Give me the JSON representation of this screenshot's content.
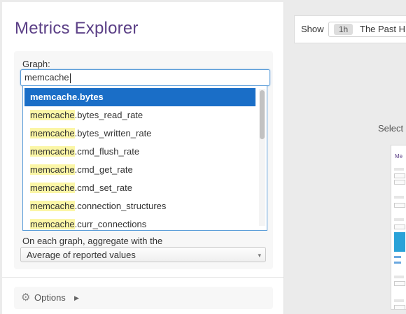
{
  "left": {
    "title": "Metrics Explorer",
    "graph_label": "Graph:",
    "search_value": "memcache",
    "suggestions": [
      {
        "match": "memcache",
        "rest": ".bytes",
        "selected": true
      },
      {
        "match": "memcache",
        "rest": ".bytes_read_rate",
        "selected": false
      },
      {
        "match": "memcache",
        "rest": ".bytes_written_rate",
        "selected": false
      },
      {
        "match": "memcache",
        "rest": ".cmd_flush_rate",
        "selected": false
      },
      {
        "match": "memcache",
        "rest": ".cmd_get_rate",
        "selected": false
      },
      {
        "match": "memcache",
        "rest": ".cmd_set_rate",
        "selected": false
      },
      {
        "match": "memcache",
        "rest": ".connection_structures",
        "selected": false
      },
      {
        "match": "memcache",
        "rest": ".curr_connections",
        "selected": false
      }
    ],
    "aggregate_label": "On each graph, aggregate with the",
    "aggregate_value": "Average of reported values",
    "options_label": "Options"
  },
  "right": {
    "show_label": "Show",
    "time_badge": "1h",
    "time_text": "The Past H",
    "select_prompt": "Select"
  },
  "colors": {
    "title": "#5b3f86",
    "selected_bg": "#1a6ec7",
    "highlight": "#fbf6a6",
    "focus_border": "#5b9dd9"
  },
  "icons": [
    "gear-icon",
    "caret-right-icon",
    "select-arrow-icon"
  ]
}
